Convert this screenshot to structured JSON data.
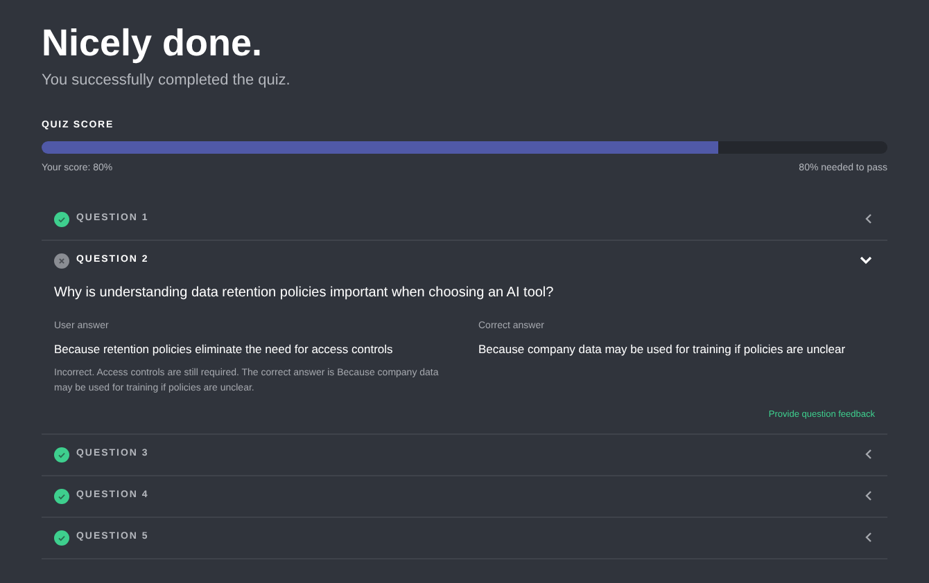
{
  "heading": "Nicely done.",
  "subheading": "You successfully completed the quiz.",
  "score": {
    "label": "QUIZ SCORE",
    "level": 0.8,
    "your_score": "Your score: 80%",
    "needed": "80% needed to pass"
  },
  "questions": [
    {
      "title": "QUESTION 1",
      "correct": true,
      "expanded": false
    },
    {
      "title": "QUESTION 2",
      "correct": false,
      "expanded": true,
      "prompt": "Why is understanding data retention policies important when choosing an AI tool?",
      "user_answer_label": "User answer",
      "user_answer": "Because retention policies eliminate the need for access controls",
      "explanation": "Incorrect. Access controls are still required. The correct answer is Because company data may be used for training if policies are unclear.",
      "correct_answer_label": "Correct answer",
      "correct_answer": "Because company data may be used for training if policies are unclear",
      "feedback_link": "Provide question feedback"
    },
    {
      "title": "QUESTION 3",
      "correct": true,
      "expanded": false
    },
    {
      "title": "QUESTION 4",
      "correct": true,
      "expanded": false
    },
    {
      "title": "QUESTION 5",
      "correct": true,
      "expanded": false
    }
  ]
}
